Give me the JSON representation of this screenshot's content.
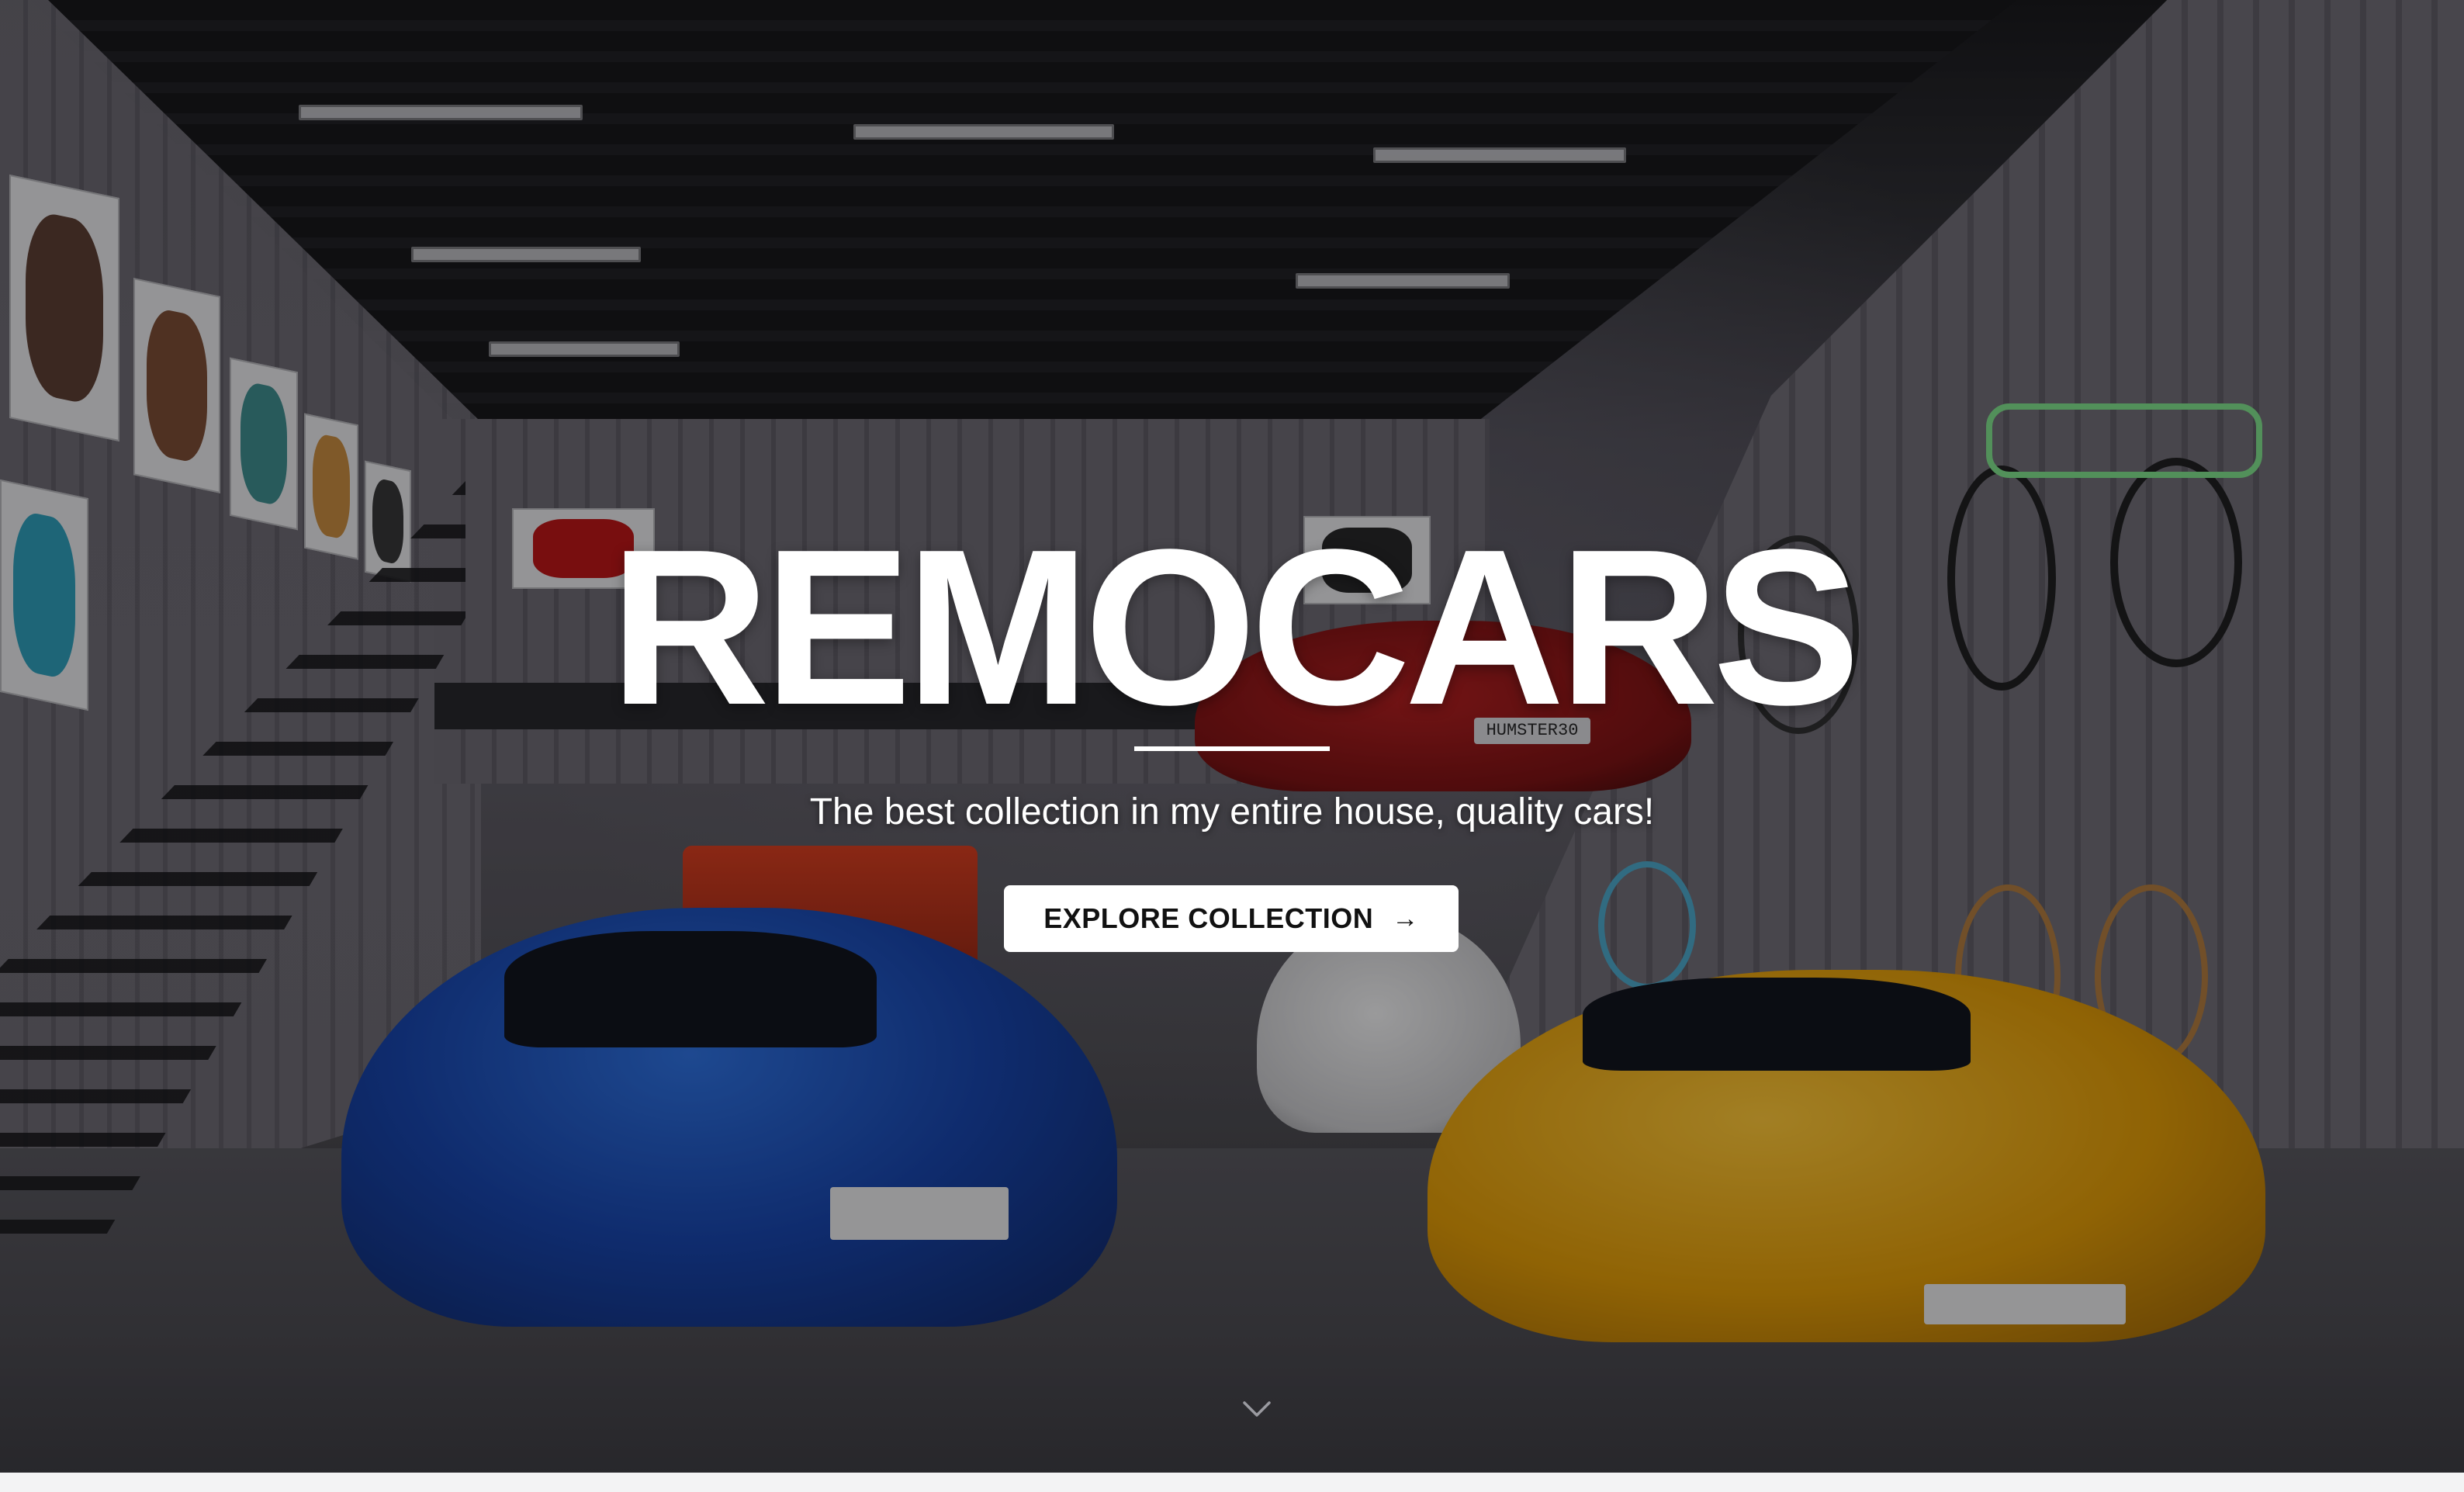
{
  "hero": {
    "brand_title": "REMOCARS",
    "tagline": "The best collection in my entire house, quality cars!",
    "cta_label": "EXPLORE COLLECTION",
    "cta_icon": "arrow-right-icon",
    "scroll_icon": "chevron-down-icon",
    "plate_text": "HUMSTER30"
  },
  "colors": {
    "title": "#ffffff",
    "cta_background": "#ffffff",
    "cta_text": "#111111",
    "overlay": "#0a0a0e"
  }
}
